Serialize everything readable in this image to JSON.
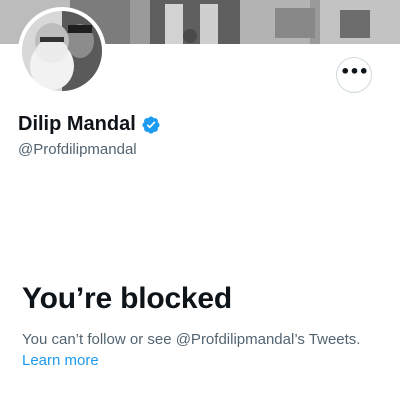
{
  "profile": {
    "display_name": "Dilip Mandal",
    "handle": "@Profdilipmandal",
    "verified": true,
    "verified_icon": "verified-badge-icon",
    "avatar_icon": "profile-photo",
    "banner_icon": "banner-image"
  },
  "actions": {
    "more_icon": "more-options-icon",
    "more_label": "•••"
  },
  "blocked": {
    "title": "You’re blocked",
    "message_part1": "You can’t follow or see @Profdilipmandal’s Tweets.",
    "link_label": "Learn more"
  },
  "colors": {
    "text_primary": "#0f1419",
    "text_secondary": "#536471",
    "accent": "#1d9bf0",
    "border": "#cfd9de"
  }
}
